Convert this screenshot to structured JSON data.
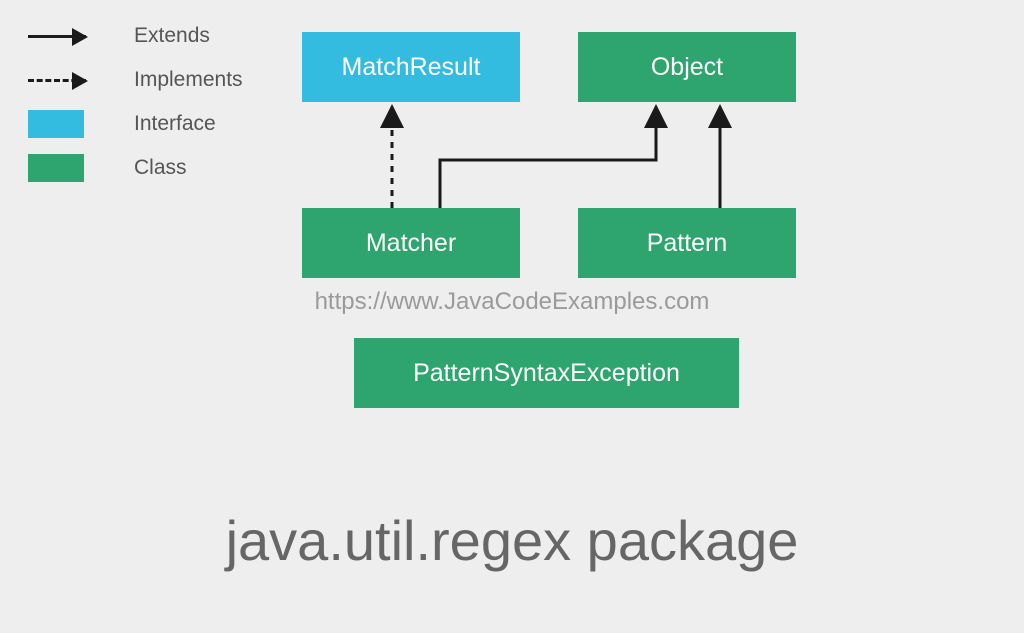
{
  "legend": {
    "extends": "Extends",
    "implements": "Implements",
    "interface": "Interface",
    "class": "Class"
  },
  "boxes": {
    "matchresult": "MatchResult",
    "object": "Object",
    "matcher": "Matcher",
    "pattern": "Pattern",
    "pse": "PatternSyntaxException"
  },
  "watermark": "https://www.JavaCodeExamples.com",
  "title": "java.util.regex package",
  "colors": {
    "interface": "#33bbe0",
    "class": "#2ea56e",
    "background": "#eeeeee",
    "text_grey": "#666666"
  },
  "chart_data": {
    "type": "class-diagram",
    "nodes": [
      {
        "name": "MatchResult",
        "kind": "interface"
      },
      {
        "name": "Object",
        "kind": "class"
      },
      {
        "name": "Matcher",
        "kind": "class"
      },
      {
        "name": "Pattern",
        "kind": "class"
      },
      {
        "name": "PatternSyntaxException",
        "kind": "class"
      }
    ],
    "edges": [
      {
        "from": "Matcher",
        "to": "MatchResult",
        "relation": "implements"
      },
      {
        "from": "Matcher",
        "to": "Object",
        "relation": "extends"
      },
      {
        "from": "Pattern",
        "to": "Object",
        "relation": "extends"
      }
    ]
  }
}
